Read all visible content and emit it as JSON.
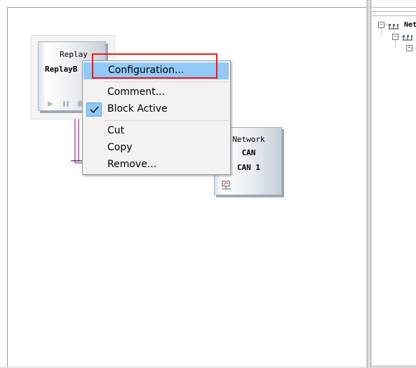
{
  "replay_block": {
    "type_label": "Replay",
    "name_label": "ReplayB",
    "controls": [
      "play-icon",
      "pause-icon",
      "stop-icon"
    ]
  },
  "network_block": {
    "type_label": "Network",
    "bus_label": "CAN",
    "channel_label": "CAN 1",
    "icon": "network-node-icon"
  },
  "context_menu": {
    "items": [
      {
        "label": "Configuration...",
        "highlighted": true
      },
      {
        "label": "Comment..."
      },
      {
        "label": "Block Active",
        "checked": true
      },
      {
        "label": "Cut"
      },
      {
        "label": "Copy"
      },
      {
        "label": "Remove..."
      }
    ]
  },
  "tree": {
    "root_label": "Net",
    "icons": [
      "network-icon",
      "network-icon"
    ]
  },
  "colors": {
    "menu_highlight": "#91c9f7",
    "annotation_box": "#ff1010",
    "connector": "#800080"
  }
}
